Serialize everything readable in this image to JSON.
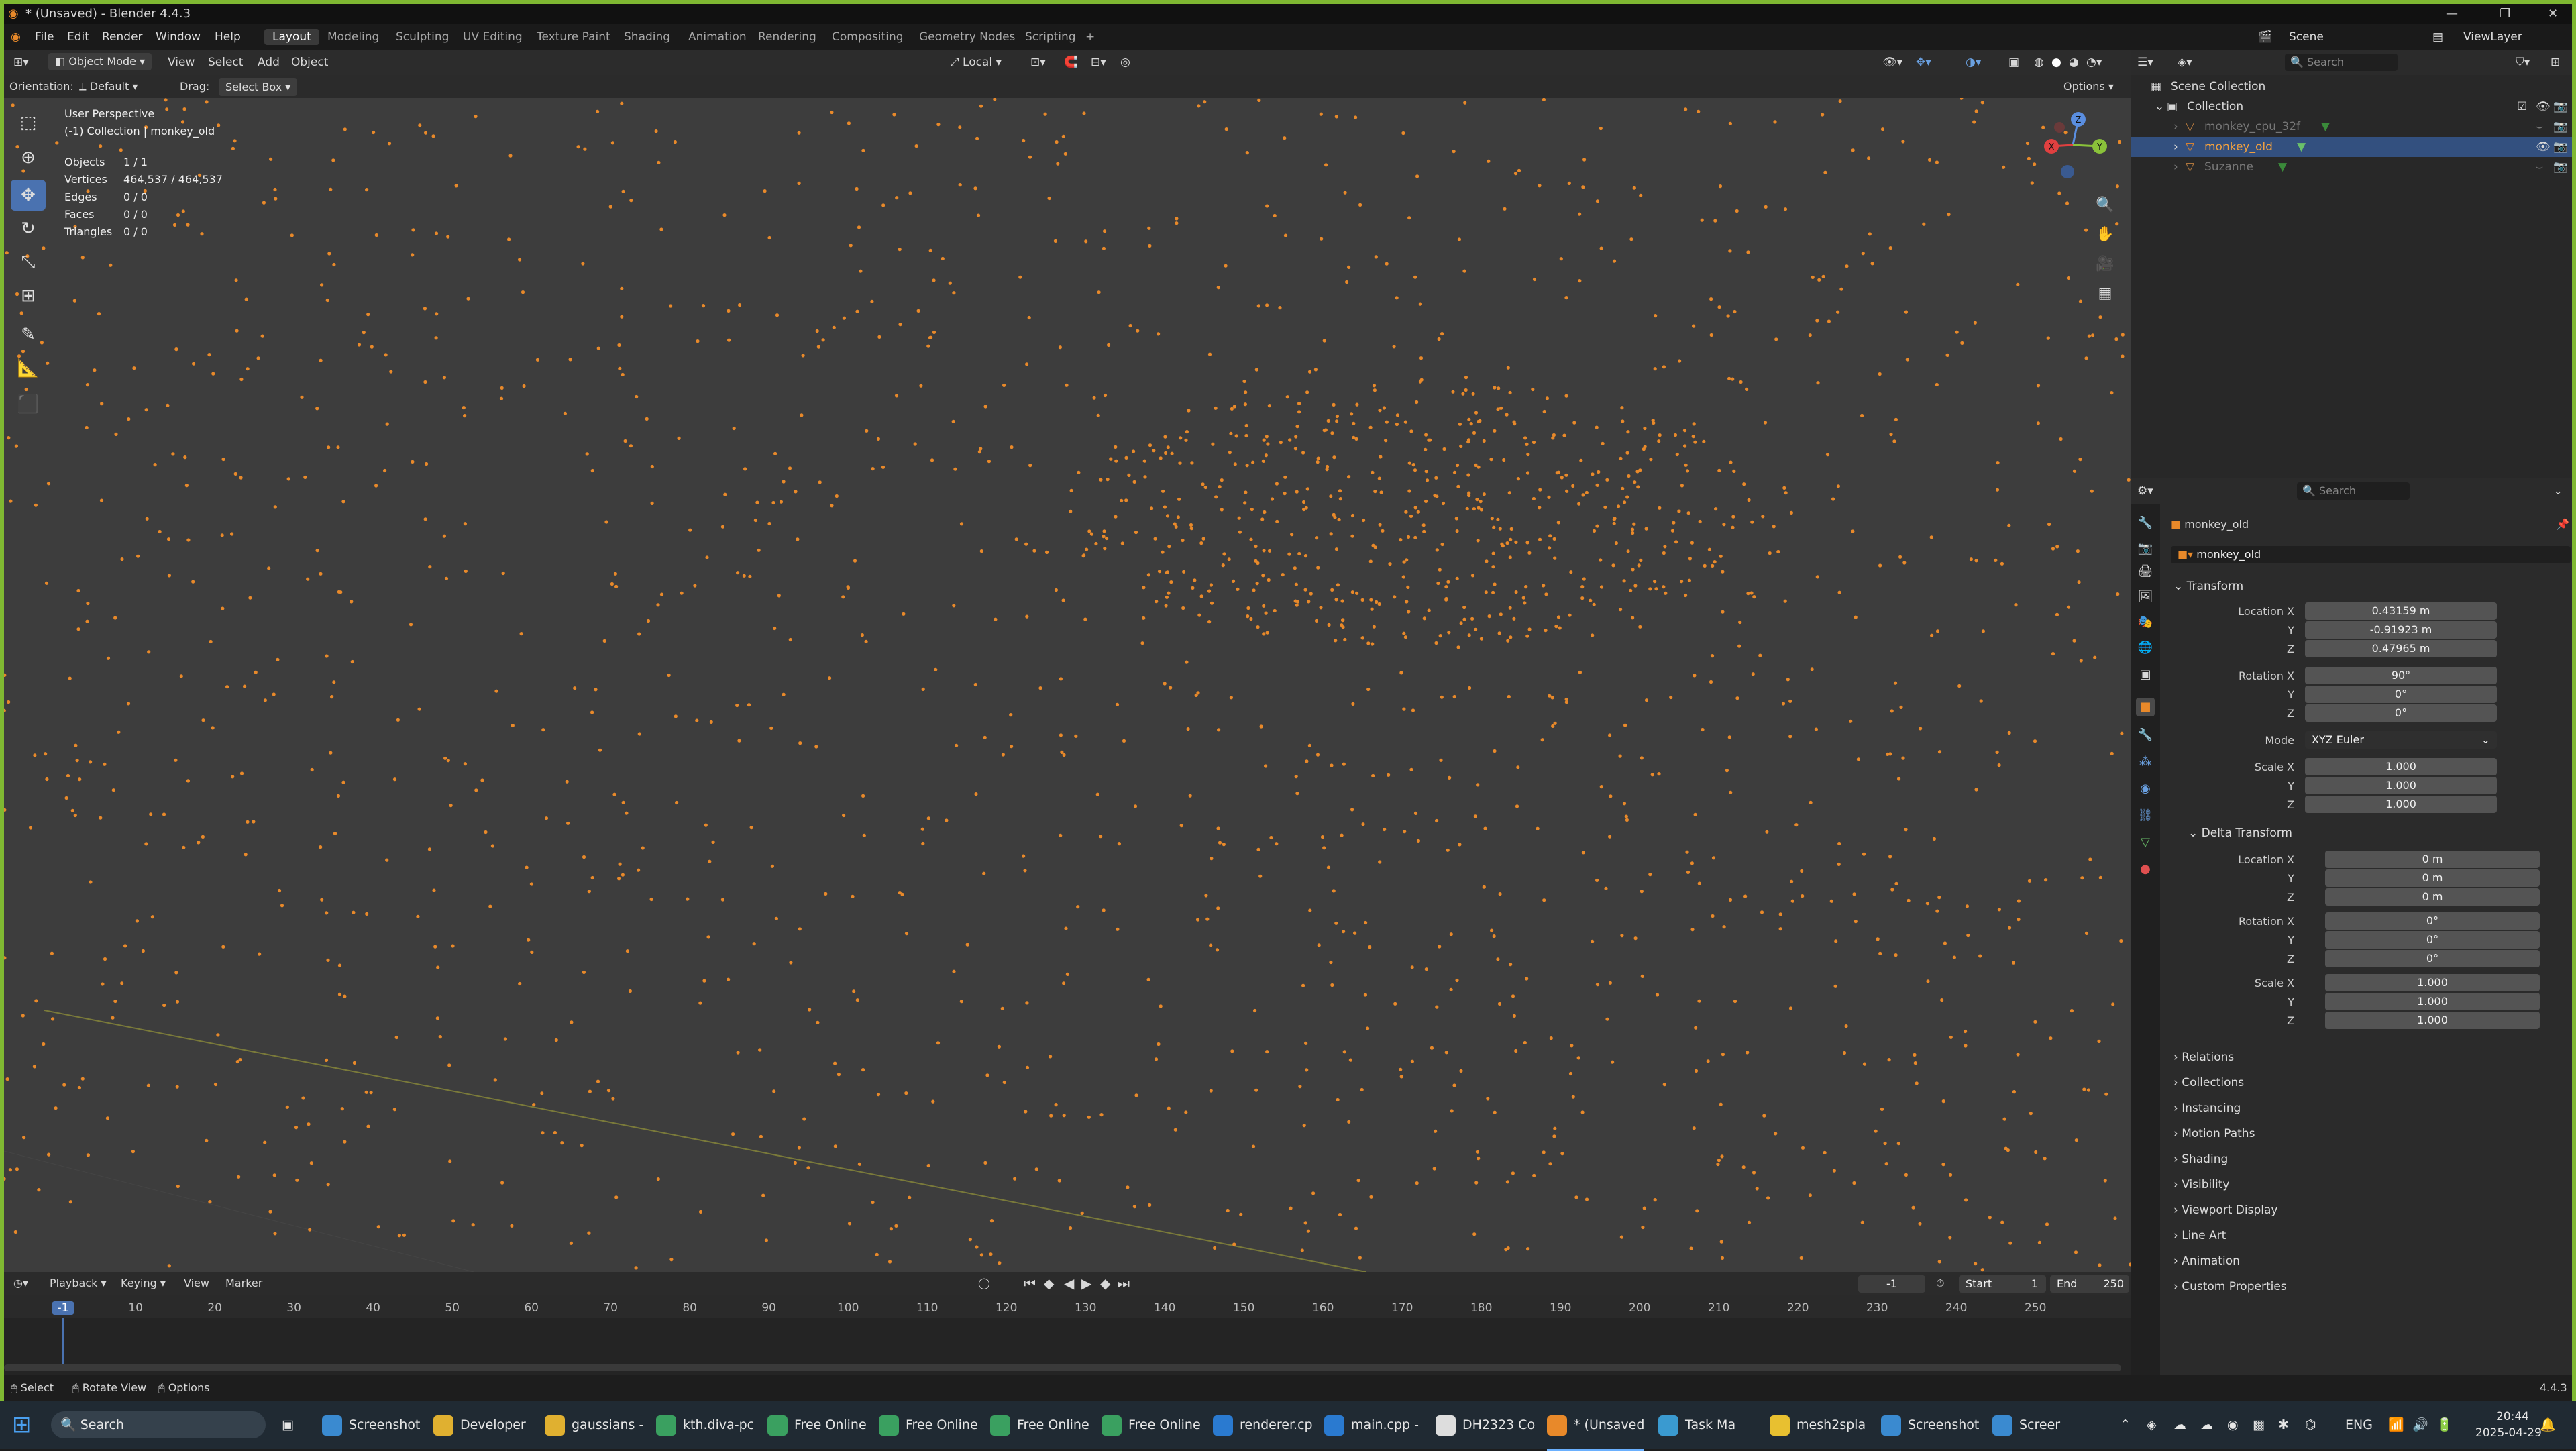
{
  "window": {
    "title": "* (Unsaved) - Blender 4.4.3"
  },
  "menu": [
    "File",
    "Edit",
    "Render",
    "Window",
    "Help"
  ],
  "workspaces": [
    "Layout",
    "Modeling",
    "Sculpting",
    "UV Editing",
    "Texture Paint",
    "Shading",
    "Animation",
    "Rendering",
    "Compositing",
    "Geometry Nodes",
    "Scripting",
    "+"
  ],
  "topbar": {
    "scene_label": "Scene",
    "viewlayer_label": "ViewLayer"
  },
  "viewport_header": {
    "mode": "Object Mode",
    "menus": [
      "View",
      "Select",
      "Add",
      "Object"
    ],
    "transform_space": "Local"
  },
  "tool_header": {
    "orientation_label": "Orientation:",
    "orientation_value": "Default",
    "drag_label": "Drag:",
    "drag_value": "Select Box",
    "options": "Options"
  },
  "overlay": {
    "perspective": "User Perspective",
    "collection": "(-1) Collection | monkey_old",
    "stats": [
      {
        "label": "Objects",
        "value": "1 / 1"
      },
      {
        "label": "Vertices",
        "value": "464,537 / 464,537"
      },
      {
        "label": "Edges",
        "value": "0 / 0"
      },
      {
        "label": "Faces",
        "value": "0 / 0"
      },
      {
        "label": "Triangles",
        "value": "0 / 0"
      }
    ]
  },
  "gizmo_axes": {
    "x": "X",
    "y": "Y",
    "z": "Z"
  },
  "timeline": {
    "menus": [
      "Playback",
      "Keying",
      "View",
      "Marker"
    ],
    "current_frame": "-1",
    "start_label": "Start",
    "start": "1",
    "end_label": "End",
    "end": "250",
    "ruler": [
      "-1",
      "10",
      "20",
      "30",
      "40",
      "50",
      "60",
      "70",
      "80",
      "90",
      "100",
      "110",
      "120",
      "130",
      "140",
      "150",
      "160",
      "170",
      "180",
      "190",
      "200",
      "210",
      "220",
      "230",
      "240",
      "250"
    ]
  },
  "statusbar": {
    "items": [
      "Select",
      "Rotate View",
      "Options"
    ],
    "version": "4.4.3"
  },
  "outliner": {
    "search_placeholder": "Search",
    "scene_collection": "Scene Collection",
    "collection": "Collection",
    "objects": [
      "monkey_cpu_32f",
      "monkey_old",
      "Suzanne"
    ]
  },
  "properties": {
    "search_placeholder": "Search",
    "object_name": "monkey_old",
    "object_field": "monkey_old",
    "transform_title": "Transform",
    "location": {
      "label_x": "Location X",
      "x": "0.43159 m",
      "y": "-0.91923 m",
      "z": "0.47965 m"
    },
    "rotation": {
      "label_x": "Rotation X",
      "x": "90°",
      "y": "0°",
      "z": "0°"
    },
    "mode_label": "Mode",
    "mode": "XYZ Euler",
    "scale": {
      "label_x": "Scale X",
      "x": "1.000",
      "y": "1.000",
      "z": "1.000"
    },
    "delta_title": "Delta Transform",
    "delta_location": {
      "x": "0 m",
      "y": "0 m",
      "z": "0 m"
    },
    "delta_rotation": {
      "x": "0°",
      "y": "0°",
      "z": "0°"
    },
    "delta_scale": {
      "x": "1.000",
      "y": "1.000",
      "z": "1.000"
    },
    "axis_y": "Y",
    "axis_z": "Z",
    "collapsed_sections": [
      "Relations",
      "Collections",
      "Instancing",
      "Motion Paths",
      "Shading",
      "Visibility",
      "Viewport Display",
      "Line Art",
      "Animation",
      "Custom Properties"
    ]
  },
  "taskbar": {
    "search": "Search",
    "apps": [
      "Screenshot",
      "Developer",
      "gaussians -",
      "kth.diva-pc",
      "Free Online",
      "Free Online",
      "Free Online",
      "Free Online",
      "renderer.cp",
      "main.cpp -",
      "DH2323 Co",
      "* (Unsaved",
      "Task Ma",
      "mesh2spla",
      "Screenshot",
      "Screer"
    ],
    "lang": "ENG",
    "time": "20:44",
    "date": "2025-04-29"
  },
  "colors": {
    "accent": "#7fb832",
    "selection": "#4a72b0",
    "points": "#e8892a",
    "viewport_bg": "#3d3d3d"
  }
}
